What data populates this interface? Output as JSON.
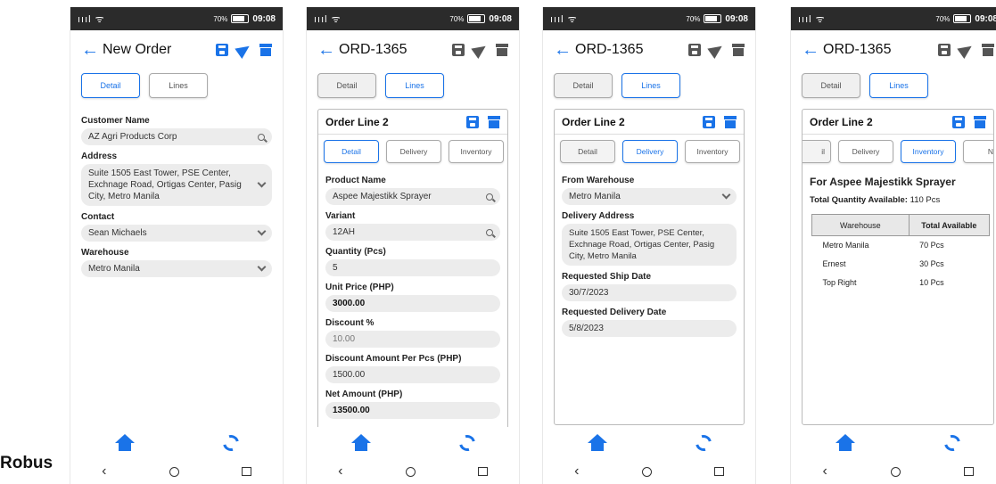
{
  "caption": "Robus",
  "status": {
    "signal": "ıııl ᯤ",
    "battery_pct": "70%",
    "time": "09:08"
  },
  "nav": {
    "back": "‹"
  },
  "screen1": {
    "title": "New Order",
    "tabs": [
      "Detail",
      "Lines"
    ],
    "fields": [
      {
        "label": "Customer Name",
        "value": "AZ Agri Products Corp",
        "icon": "search-icon"
      },
      {
        "label": "Address",
        "value": "Suite 1505 East Tower, PSE Center, Exchnage Road, Ortigas Center, Pasig City, Metro Manila",
        "icon": "chevron-down-icon"
      },
      {
        "label": "Contact",
        "value": "Sean Michaels",
        "icon": "chevron-down-icon"
      },
      {
        "label": "Warehouse",
        "value": "Metro Manila",
        "icon": "chevron-down-icon"
      }
    ]
  },
  "screen2": {
    "title": "ORD-1365",
    "tabs": [
      "Detail",
      "Lines"
    ],
    "card_title": "Order Line 2",
    "subtabs": [
      "Detail",
      "Delivery",
      "Inventory"
    ],
    "fields": [
      {
        "label": "Product Name",
        "value": "Aspee Majestikk Sprayer"
      },
      {
        "label": "Variant",
        "value": "12AH"
      },
      {
        "label": "Quantity (Pcs)",
        "value": "5"
      },
      {
        "label": "Unit Price (PHP)",
        "value": "3000.00"
      },
      {
        "label": "Discount %",
        "value": "10.00"
      },
      {
        "label": "Discount Amount Per Pcs (PHP)",
        "value": "1500.00"
      },
      {
        "label": "Net Amount (PHP)",
        "value": "13500.00"
      }
    ]
  },
  "screen3": {
    "title": "ORD-1365",
    "tabs": [
      "Detail",
      "Lines"
    ],
    "card_title": "Order Line 2",
    "subtabs": [
      "Detail",
      "Delivery",
      "Inventory"
    ],
    "fields": [
      {
        "label": "From Warehouse",
        "value": "Metro Manila"
      },
      {
        "label": "Delivery Address",
        "value": "Suite 1505 East Tower, PSE Center, Exchnage Road, Ortigas Center, Pasig City, Metro Manila"
      },
      {
        "label": "Requested Ship Date",
        "value": "30/7/2023"
      },
      {
        "label": "Requested Delivery Date",
        "value": "5/8/2023"
      }
    ]
  },
  "screen4": {
    "title": "ORD-1365",
    "tabs": [
      "Detail",
      "Lines"
    ],
    "card_title": "Order Line 2",
    "subtabs": [
      "il",
      "Delivery",
      "Inventory",
      "N"
    ],
    "product_heading": "For Aspee Majestikk Sprayer",
    "total_label": "Total Quantity Available:",
    "total_value": "110 Pcs",
    "columns": [
      "Warehouse",
      "Total Available"
    ],
    "rows": [
      {
        "warehouse": "Metro Manila",
        "available": "70 Pcs"
      },
      {
        "warehouse": "Ernest",
        "available": "30 Pcs"
      },
      {
        "warehouse": "Top Right",
        "available": "10 Pcs"
      }
    ]
  }
}
